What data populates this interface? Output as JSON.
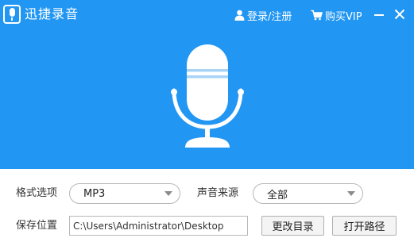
{
  "app": {
    "title": "迅捷录音",
    "accent_color": "#2196f3"
  },
  "header": {
    "login_label": "登录/注册",
    "vip_label": "购买VIP",
    "login_icon": "user-icon",
    "vip_icon": "cart-icon",
    "minimize_icon": "minimize-icon",
    "close_icon": "close-icon"
  },
  "hero": {
    "icon": "microphone-icon"
  },
  "settings": {
    "format_label": "格式选项",
    "format_value": "MP3",
    "source_label": "声音来源",
    "source_value": "全部",
    "save_label": "保存位置",
    "save_path": "C:\\Users\\Administrator\\Desktop",
    "change_dir_label": "更改目录",
    "open_path_label": "打开路径"
  }
}
